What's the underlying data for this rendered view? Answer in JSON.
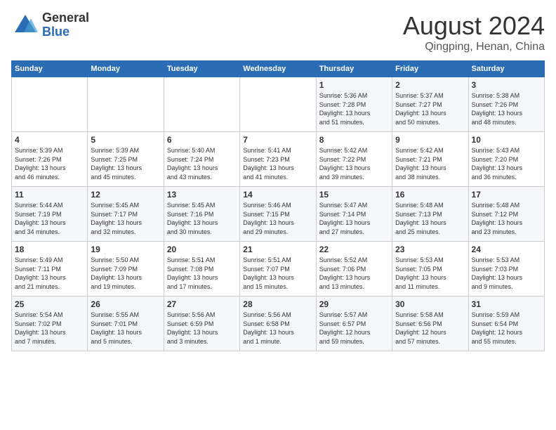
{
  "logo": {
    "general": "General",
    "blue": "Blue"
  },
  "header": {
    "month": "August 2024",
    "location": "Qingping, Henan, China"
  },
  "weekdays": [
    "Sunday",
    "Monday",
    "Tuesday",
    "Wednesday",
    "Thursday",
    "Friday",
    "Saturday"
  ],
  "weeks": [
    [
      {
        "day": "",
        "info": ""
      },
      {
        "day": "",
        "info": ""
      },
      {
        "day": "",
        "info": ""
      },
      {
        "day": "",
        "info": ""
      },
      {
        "day": "1",
        "info": "Sunrise: 5:36 AM\nSunset: 7:28 PM\nDaylight: 13 hours\nand 51 minutes."
      },
      {
        "day": "2",
        "info": "Sunrise: 5:37 AM\nSunset: 7:27 PM\nDaylight: 13 hours\nand 50 minutes."
      },
      {
        "day": "3",
        "info": "Sunrise: 5:38 AM\nSunset: 7:26 PM\nDaylight: 13 hours\nand 48 minutes."
      }
    ],
    [
      {
        "day": "4",
        "info": "Sunrise: 5:39 AM\nSunset: 7:26 PM\nDaylight: 13 hours\nand 46 minutes."
      },
      {
        "day": "5",
        "info": "Sunrise: 5:39 AM\nSunset: 7:25 PM\nDaylight: 13 hours\nand 45 minutes."
      },
      {
        "day": "6",
        "info": "Sunrise: 5:40 AM\nSunset: 7:24 PM\nDaylight: 13 hours\nand 43 minutes."
      },
      {
        "day": "7",
        "info": "Sunrise: 5:41 AM\nSunset: 7:23 PM\nDaylight: 13 hours\nand 41 minutes."
      },
      {
        "day": "8",
        "info": "Sunrise: 5:42 AM\nSunset: 7:22 PM\nDaylight: 13 hours\nand 39 minutes."
      },
      {
        "day": "9",
        "info": "Sunrise: 5:42 AM\nSunset: 7:21 PM\nDaylight: 13 hours\nand 38 minutes."
      },
      {
        "day": "10",
        "info": "Sunrise: 5:43 AM\nSunset: 7:20 PM\nDaylight: 13 hours\nand 36 minutes."
      }
    ],
    [
      {
        "day": "11",
        "info": "Sunrise: 5:44 AM\nSunset: 7:19 PM\nDaylight: 13 hours\nand 34 minutes."
      },
      {
        "day": "12",
        "info": "Sunrise: 5:45 AM\nSunset: 7:17 PM\nDaylight: 13 hours\nand 32 minutes."
      },
      {
        "day": "13",
        "info": "Sunrise: 5:45 AM\nSunset: 7:16 PM\nDaylight: 13 hours\nand 30 minutes."
      },
      {
        "day": "14",
        "info": "Sunrise: 5:46 AM\nSunset: 7:15 PM\nDaylight: 13 hours\nand 29 minutes."
      },
      {
        "day": "15",
        "info": "Sunrise: 5:47 AM\nSunset: 7:14 PM\nDaylight: 13 hours\nand 27 minutes."
      },
      {
        "day": "16",
        "info": "Sunrise: 5:48 AM\nSunset: 7:13 PM\nDaylight: 13 hours\nand 25 minutes."
      },
      {
        "day": "17",
        "info": "Sunrise: 5:48 AM\nSunset: 7:12 PM\nDaylight: 13 hours\nand 23 minutes."
      }
    ],
    [
      {
        "day": "18",
        "info": "Sunrise: 5:49 AM\nSunset: 7:11 PM\nDaylight: 13 hours\nand 21 minutes."
      },
      {
        "day": "19",
        "info": "Sunrise: 5:50 AM\nSunset: 7:09 PM\nDaylight: 13 hours\nand 19 minutes."
      },
      {
        "day": "20",
        "info": "Sunrise: 5:51 AM\nSunset: 7:08 PM\nDaylight: 13 hours\nand 17 minutes."
      },
      {
        "day": "21",
        "info": "Sunrise: 5:51 AM\nSunset: 7:07 PM\nDaylight: 13 hours\nand 15 minutes."
      },
      {
        "day": "22",
        "info": "Sunrise: 5:52 AM\nSunset: 7:06 PM\nDaylight: 13 hours\nand 13 minutes."
      },
      {
        "day": "23",
        "info": "Sunrise: 5:53 AM\nSunset: 7:05 PM\nDaylight: 13 hours\nand 11 minutes."
      },
      {
        "day": "24",
        "info": "Sunrise: 5:53 AM\nSunset: 7:03 PM\nDaylight: 13 hours\nand 9 minutes."
      }
    ],
    [
      {
        "day": "25",
        "info": "Sunrise: 5:54 AM\nSunset: 7:02 PM\nDaylight: 13 hours\nand 7 minutes."
      },
      {
        "day": "26",
        "info": "Sunrise: 5:55 AM\nSunset: 7:01 PM\nDaylight: 13 hours\nand 5 minutes."
      },
      {
        "day": "27",
        "info": "Sunrise: 5:56 AM\nSunset: 6:59 PM\nDaylight: 13 hours\nand 3 minutes."
      },
      {
        "day": "28",
        "info": "Sunrise: 5:56 AM\nSunset: 6:58 PM\nDaylight: 13 hours\nand 1 minute."
      },
      {
        "day": "29",
        "info": "Sunrise: 5:57 AM\nSunset: 6:57 PM\nDaylight: 12 hours\nand 59 minutes."
      },
      {
        "day": "30",
        "info": "Sunrise: 5:58 AM\nSunset: 6:56 PM\nDaylight: 12 hours\nand 57 minutes."
      },
      {
        "day": "31",
        "info": "Sunrise: 5:59 AM\nSunset: 6:54 PM\nDaylight: 12 hours\nand 55 minutes."
      }
    ]
  ]
}
